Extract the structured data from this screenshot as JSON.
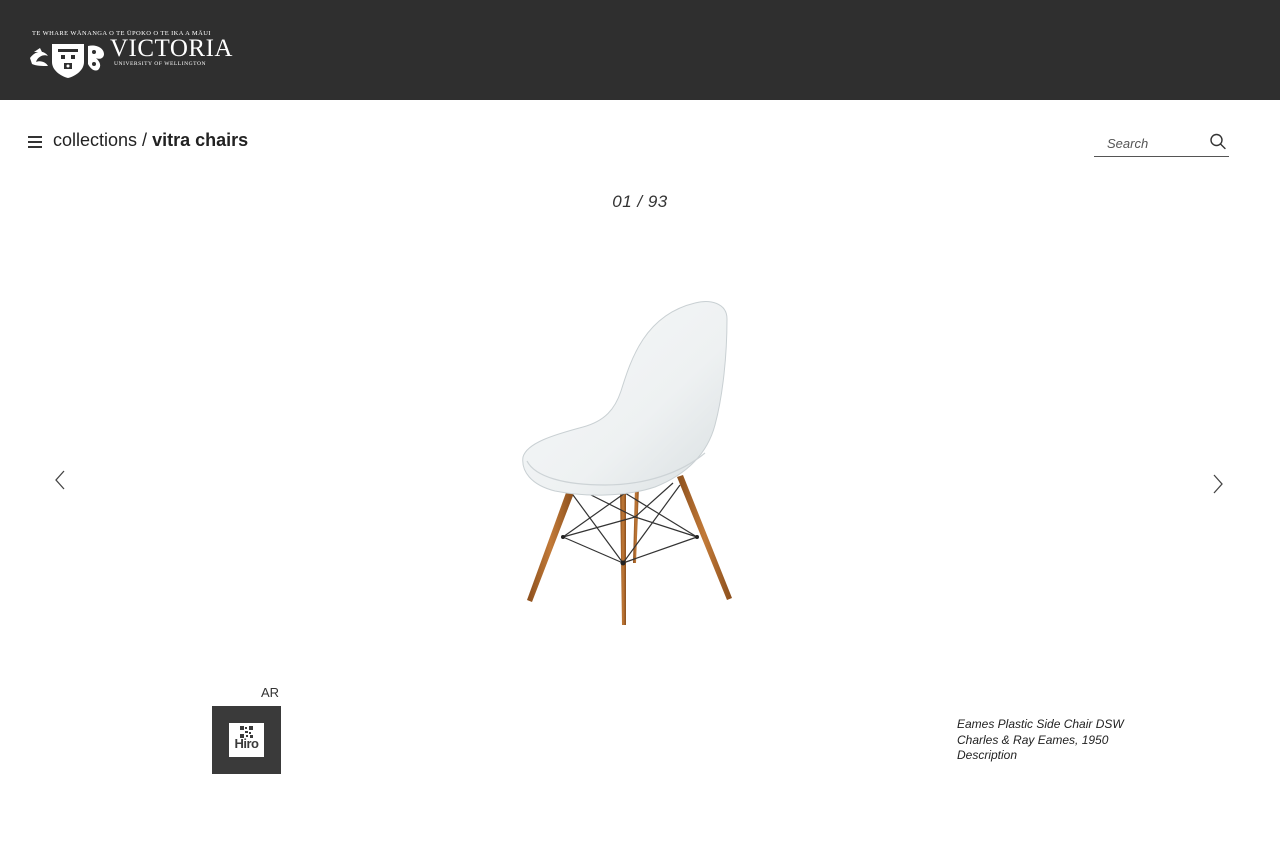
{
  "header": {
    "logo": {
      "motto": "TE WHARE WĀNANGA O TE ŪPOKO O TE IKA A MĀUI",
      "name": "VICTORIA",
      "subtitle": "UNIVERSITY OF WELLINGTON"
    }
  },
  "breadcrumb": {
    "parent": "collections",
    "separator": " / ",
    "current": "vitra chairs"
  },
  "search": {
    "placeholder": "Search",
    "value": ""
  },
  "viewer": {
    "counter": "01 / 93"
  },
  "ar": {
    "label": "AR",
    "brand": "Hiro"
  },
  "caption": {
    "title": "Eames Plastic Side Chair DSW",
    "credit": "Charles & Ray Eames, 1950",
    "description_link": "Description"
  },
  "colors": {
    "header_bg": "#2f2f2f",
    "ar_tile_bg": "#3a3a3a",
    "chair_shell": "#eef1f2",
    "chair_legs": "#b0672a"
  },
  "icons": {
    "menu": "hamburger-icon",
    "search": "search-icon",
    "prev": "chevron-left-icon",
    "next": "chevron-right-icon"
  }
}
